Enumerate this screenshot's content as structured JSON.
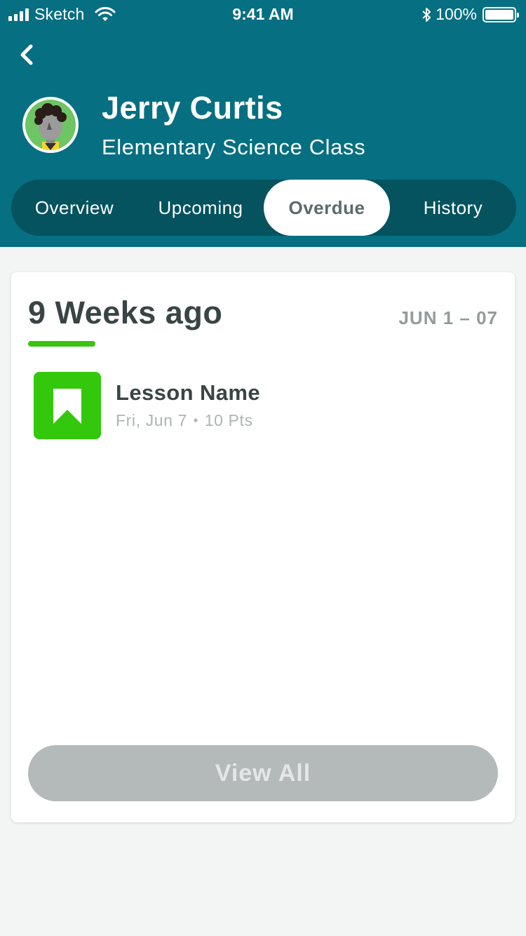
{
  "status_bar": {
    "carrier": "Sketch",
    "time": "9:41 AM",
    "battery": "100%",
    "icons": [
      "signal-icon",
      "wifi-icon",
      "bluetooth-icon",
      "battery-icon"
    ]
  },
  "header": {
    "back_icon": "chevron-left-icon",
    "student_name": "Jerry Curtis",
    "class_name": "Elementary Science Class",
    "background_color": "#066f82"
  },
  "tabs": [
    {
      "label": "Overview",
      "active": false
    },
    {
      "label": "Upcoming",
      "active": false
    },
    {
      "label": "Overdue",
      "active": true
    },
    {
      "label": "History",
      "active": false
    }
  ],
  "card": {
    "period_title": "9 Weeks ago",
    "period_range": "JUN 1 – 07",
    "accent_color": "#39c40f",
    "lessons": [
      {
        "icon": "bookmark-icon",
        "name": "Lesson Name",
        "date": "Fri, Jun 7",
        "separator": "•",
        "points": "10 Pts"
      }
    ],
    "view_all_label": "View All"
  }
}
